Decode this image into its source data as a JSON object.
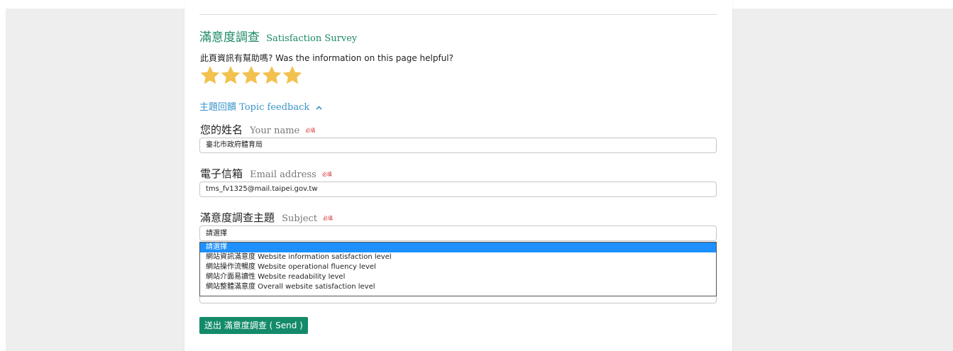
{
  "survey": {
    "title_zh": "滿意度調查",
    "title_en": "Satisfaction Survey",
    "question": "此頁資訊有幫助嗎? Was the information on this page helpful?",
    "rating": {
      "value": 5,
      "max": 5
    },
    "star_color": "#f2c14e"
  },
  "topic_feedback": {
    "label_zh": "主題回饋",
    "label_en": "Topic feedback",
    "expanded": true
  },
  "form": {
    "required_text": "必填",
    "name": {
      "label_zh": "您的姓名",
      "label_en": "Your name",
      "value": "臺北市政府體育局"
    },
    "email": {
      "label_zh": "電子信箱",
      "label_en": "Email address",
      "value": "tms_fv1325@mail.taipei.gov.tw"
    },
    "subject": {
      "label_zh": "滿意度調查主題",
      "label_en": "Subject",
      "value": "請選擇",
      "options": [
        "請選擇",
        "網站資訊滿意度 Website information satisfaction level",
        "網站操作流暢度 Website operational fluency level",
        "網站介面易讀性 Website readability level",
        "網站整體滿意度 Overall website satisfaction level"
      ],
      "highlighted_index": 0
    },
    "send_label": "送出 滿意度調查 ( Send )"
  },
  "colors": {
    "accent_green": "#1a8a63",
    "link_blue": "#3a94c8",
    "button_green": "#138b6a",
    "required_red": "#d03030",
    "option_highlight": "#1e90ff"
  }
}
